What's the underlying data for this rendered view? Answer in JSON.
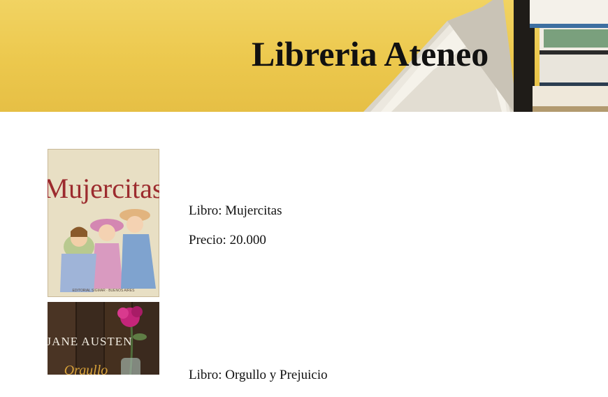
{
  "header": {
    "title": "Libreria Ateneo",
    "background_color": "#ecc84d"
  },
  "books": [
    {
      "cover_title": "Mujercitas",
      "cover_publisher": "EDITORIAL SIGMAR · BUENOS AIRES",
      "name_label": "Libro: Mujercitas",
      "price_label": "Precio: 20.000"
    },
    {
      "cover_author": "JANE AUSTEN",
      "cover_title": "Orgullo",
      "name_label": "Libro: Orgullo y Prejuicio"
    }
  ]
}
